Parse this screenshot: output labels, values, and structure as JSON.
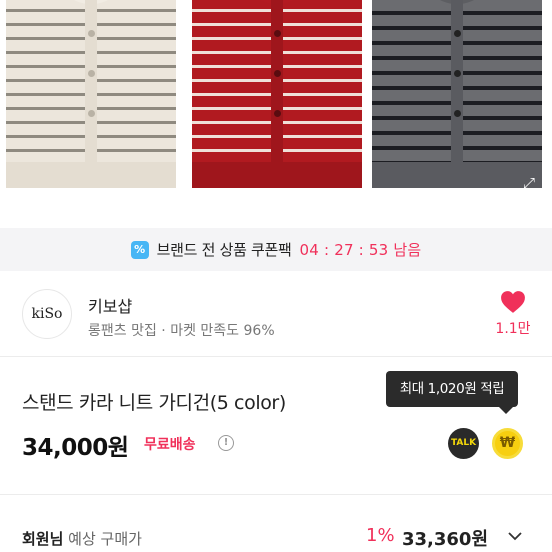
{
  "coupon": {
    "label": "브랜드 전 상품 쿠폰팩",
    "timer": "04 : 27 : 53 남음",
    "icon": "coupon-percent-icon",
    "icon_glyph": "%"
  },
  "shop": {
    "logo_text": "kiSo",
    "name": "키보샵",
    "description": "롱팬츠 맛집 · 마켓 만족도 96%",
    "like_count": "1.1만"
  },
  "product": {
    "title": "스탠드 카라 니트 가디건(5 color)",
    "price": "34,000원",
    "free_shipping": "무료배송",
    "info_glyph": "!",
    "talk_label": "TALK",
    "won_glyph": "₩",
    "reward_tooltip": "최대 1,020원 적립"
  },
  "member": {
    "label_strong": "회원님",
    "label_light": " 예상 구매가",
    "discount": "1%",
    "price": "33,360원"
  },
  "colors": {
    "accent": "#f0305a",
    "coupon_bg": "#f4f4f6",
    "tooltip_bg": "#2b2b2b"
  }
}
